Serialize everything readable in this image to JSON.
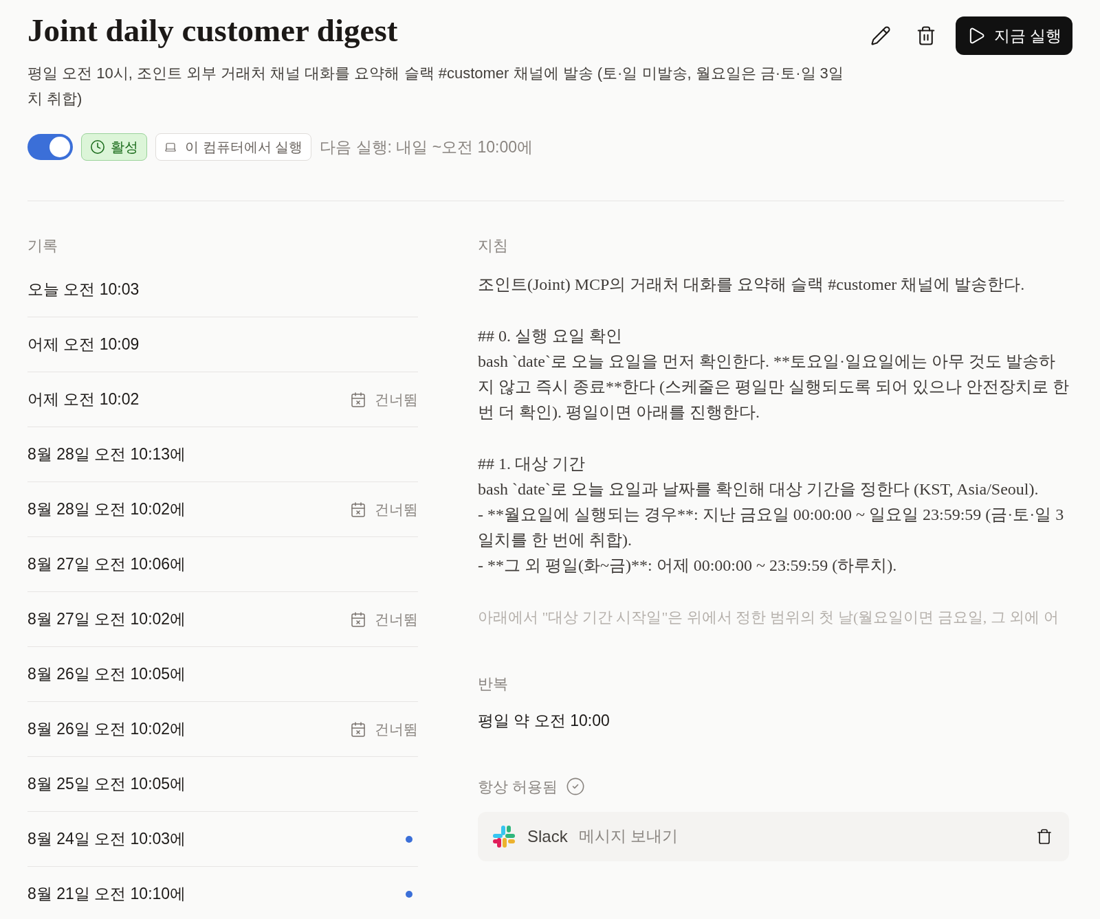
{
  "title": "Joint daily customer digest",
  "toolbar": {
    "run_button": "지금 실행"
  },
  "description": "평일 오전 10시, 조인트 외부 거래처 채널 대화를 요약해 슬랙 #customer 채널에 발송 (토·일 미발송, 월요일은 금·토·일 3일치 취합)",
  "status": {
    "enabled": true,
    "badge": "활성",
    "location": "이 컴퓨터에서 실행",
    "next_run": "다음 실행: 내일 ~오전 10:00에"
  },
  "history": {
    "heading": "기록",
    "runs": [
      {
        "time": "오늘 오전 10:03",
        "kind": "done"
      },
      {
        "time": "어제 오전 10:09",
        "kind": "done"
      },
      {
        "time": "어제 오전 10:02",
        "kind": "skipped",
        "note": "건너뜀"
      },
      {
        "time": "8월 28일 오전 10:13에",
        "kind": "done"
      },
      {
        "time": "8월 28일 오전 10:02에",
        "kind": "skipped",
        "note": "건너뜀"
      },
      {
        "time": "8월 27일 오전 10:06에",
        "kind": "done"
      },
      {
        "time": "8월 27일 오전 10:02에",
        "kind": "skipped",
        "note": "건너뜀"
      },
      {
        "time": "8월 26일 오전 10:05에",
        "kind": "done"
      },
      {
        "time": "8월 26일 오전 10:02에",
        "kind": "skipped",
        "note": "건너뜀"
      },
      {
        "time": "8월 25일 오전 10:05에",
        "kind": "done"
      },
      {
        "time": "8월 24일 오전 10:03에",
        "kind": "unread"
      },
      {
        "time": "8월 21일 오전 10:10에",
        "kind": "unread"
      }
    ]
  },
  "instructions": {
    "heading": "지침",
    "blocks": [
      [
        "조인트(Joint) MCP의 거래처 대화를 요약해 슬랙 #customer 채널에 발송한다."
      ],
      [
        "## 0. 실행 요일 확인",
        "bash `date`로 오늘 요일을 먼저 확인한다. **토요일·일요일에는 아무 것도 발송하지 않고 즉시 종료**한다 (스케줄은 평일만 실행되도록 되어 있으나 안전장치로 한 번 더 확인). 평일이면 아래를 진행한다."
      ],
      [
        "## 1. 대상 기간",
        "bash `date`로 오늘 요일과 날짜를 확인해 대상 기간을 정한다 (KST, Asia/Seoul).",
        "- **월요일에 실행되는 경우**: 지난 금요일 00:00:00 ~ 일요일 23:59:59 (금·토·일 3일치를 한 번에 취합).",
        "- **그 외 평일(화~금)**: 어제 00:00:00 ~ 23:59:59 (하루치)."
      ]
    ],
    "faded_line": "아래에서 \"대상 기간 시작일\"은 위에서 정한 범위의 첫 날(월요일이면 금요일, 그 외에 어"
  },
  "repeat": {
    "heading": "반복",
    "value": "평일 약 오전 10:00"
  },
  "permissions": {
    "heading": "항상 허용됨",
    "items": [
      {
        "app": "Slack",
        "action": "메시지 보내기"
      }
    ]
  }
}
